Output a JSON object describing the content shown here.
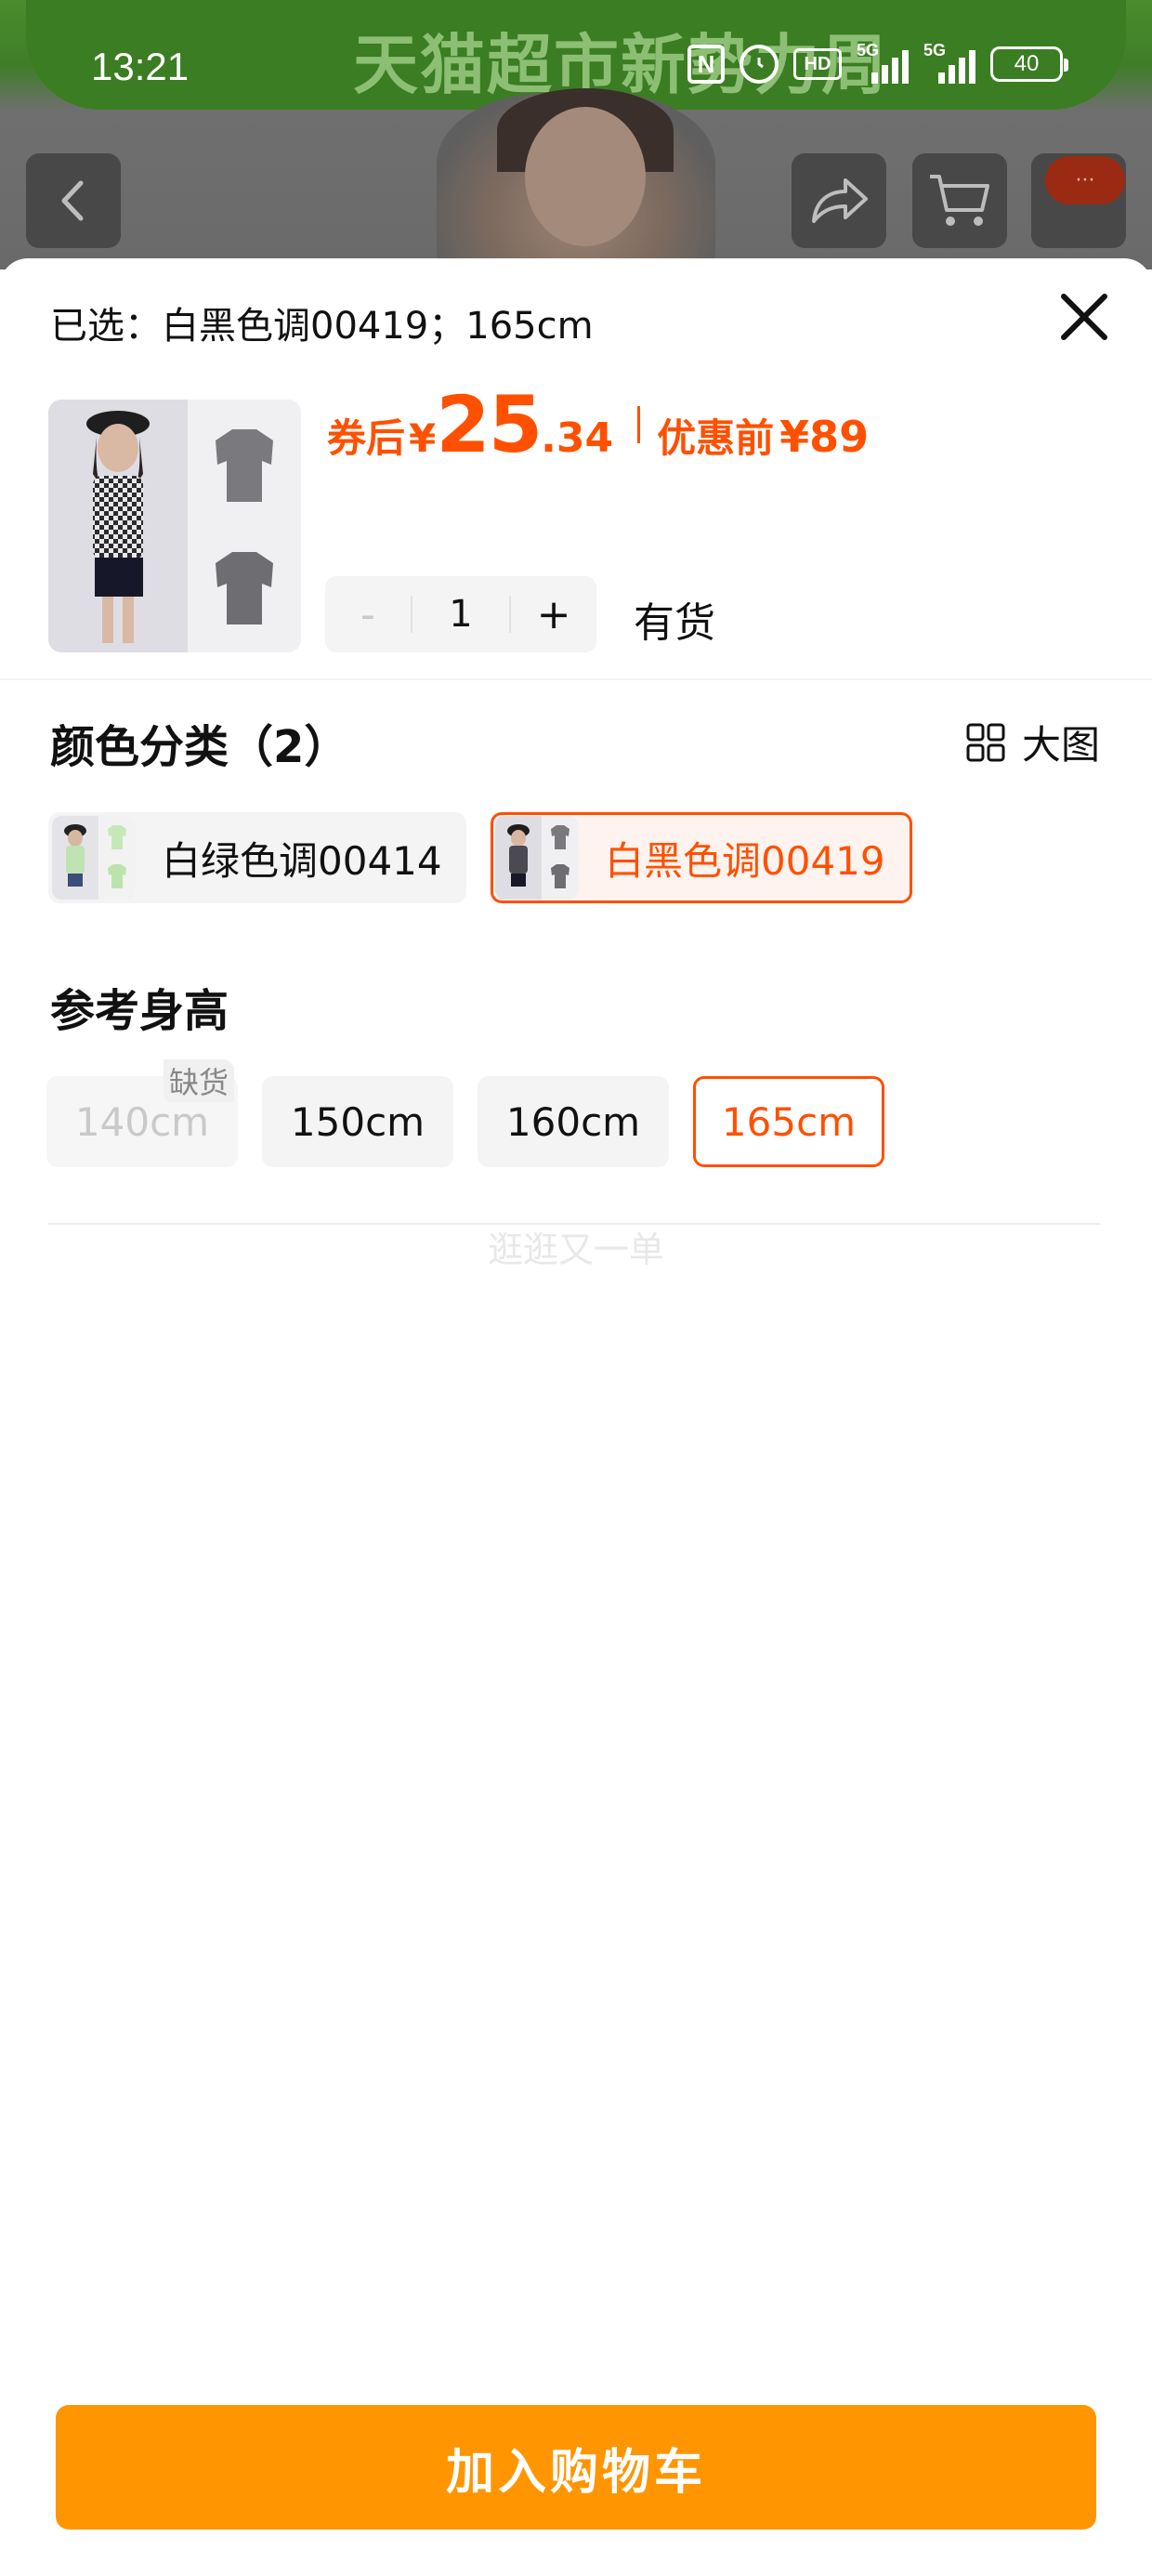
{
  "status_bar": {
    "time": "13:21",
    "nfc": "N",
    "hd": "HD",
    "sig1": "5G",
    "sig2": "5G",
    "battery": "40"
  },
  "background": {
    "banner_text": "天猫超市新势力周"
  },
  "sheet": {
    "selected_label": "已选：白黑色调00419；165cm",
    "price": {
      "prefix": "券后",
      "currency": "¥",
      "integer": "25",
      "decimal": ".34",
      "before_label": "优惠前",
      "before_value": "¥89"
    },
    "quantity": {
      "minus": "-",
      "value": "1",
      "plus": "+"
    },
    "stock": "有货",
    "color_section": {
      "title": "颜色分类（2）",
      "big_image_label": "大图",
      "options": [
        {
          "label": "白绿色调00414",
          "selected": false
        },
        {
          "label": "白黑色调00419",
          "selected": true
        }
      ]
    },
    "height_section": {
      "title": "参考身高",
      "options": [
        {
          "label": "140cm",
          "state": "out_of_stock",
          "tag": "缺货"
        },
        {
          "label": "150cm",
          "state": "normal"
        },
        {
          "label": "160cm",
          "state": "normal"
        },
        {
          "label": "165cm",
          "state": "selected"
        }
      ]
    },
    "footer_hint": "逛逛又一单",
    "add_to_cart": "加入购物车"
  },
  "colors": {
    "accent": "#ff5000",
    "button": "#ff9500"
  }
}
